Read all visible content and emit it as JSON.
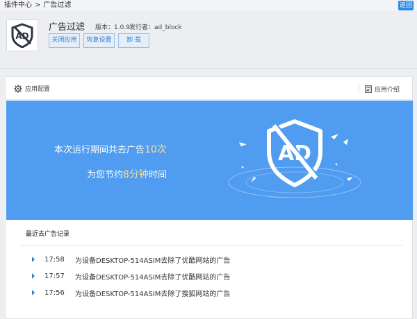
{
  "breadcrumb": {
    "root": "插件中心",
    "separator": ">",
    "current": "广告过滤"
  },
  "back_label": "返回",
  "app": {
    "title": "广告过滤",
    "version_label": "版本：1.0.9",
    "publisher_label": "发行者：ad_block",
    "buttons": {
      "close": "关闭应用",
      "restore": "恢复设置",
      "uninstall": "卸 载"
    }
  },
  "panel": {
    "config_label": "应用配置",
    "intro_label": "应用介绍"
  },
  "banner": {
    "line1_prefix": "本次运行期间共去广告",
    "line1_count": "10次",
    "line2_prefix": "为您节约",
    "line2_value": "8分钟",
    "line2_suffix": "时间"
  },
  "records": {
    "title": "最近去广告记录",
    "items": [
      {
        "time": "17:58",
        "text": "为设备DESKTOP-514ASIM去除了优酷网站的广告"
      },
      {
        "time": "17:57",
        "text": "为设备DESKTOP-514ASIM去除了优酷网站的广告"
      },
      {
        "time": "17:56",
        "text": "为设备DESKTOP-514ASIM去除了搜狐网站的广告"
      }
    ]
  },
  "colors": {
    "accent": "#2b8ae6",
    "banner": "#4f9cf0",
    "highlight": "#ffe08a"
  },
  "icons": {
    "logo": "ad-shield-icon",
    "config": "gear-icon",
    "intro": "document-icon",
    "row": "caret-right-icon"
  }
}
